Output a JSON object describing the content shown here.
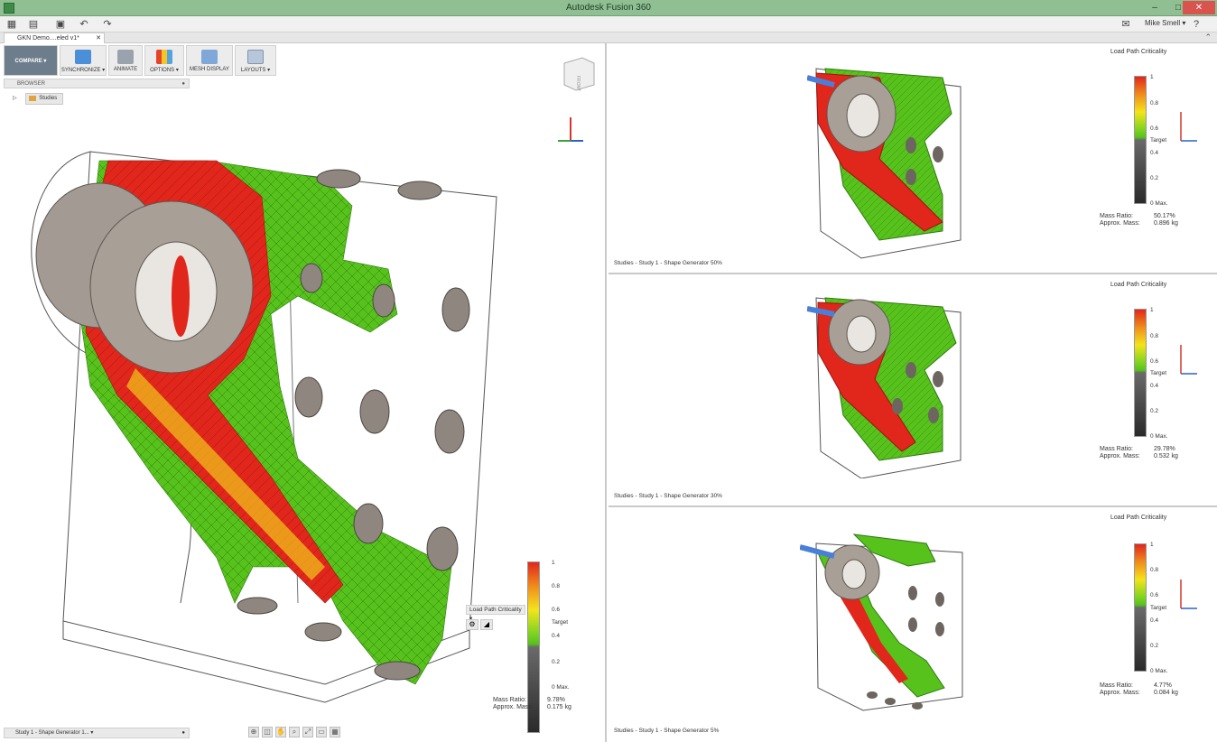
{
  "window": {
    "title": "Autodesk Fusion 360",
    "min": "–",
    "max": "□",
    "close": "✕"
  },
  "quick_access": {
    "user_name": "Mike Smell ▾",
    "help": "?"
  },
  "doc_tab": {
    "label": "GKN Demo....eled v1*",
    "close": "✕"
  },
  "toolbar": {
    "compare": "COMPARE ▾",
    "synchronize": "SYNCHRONIZE ▾",
    "animate": "ANIMATE",
    "options": "OPTIONS ▾",
    "mesh_display": "MESH DISPLAY",
    "layouts": "LAYOUTS ▾"
  },
  "browser": {
    "label": "BROWSER",
    "studies": "Studies"
  },
  "main_view": {
    "legend_dropdown": "Load Path Criticality ▾",
    "legend_ticks": [
      "1",
      "0.8",
      "0.6",
      "Target",
      "0.4",
      "0.2",
      "0 Max."
    ],
    "mass_ratio_label": "Mass Ratio:",
    "mass_ratio_value": "9.78%",
    "approx_mass_label": "Approx. Mass:",
    "approx_mass_value": "0.175 kg",
    "study_dropdown": "Study 1 - Shape Generator 1... ▾"
  },
  "panels": [
    {
      "legend_title": "Load Path Criticality",
      "legend_ticks": [
        "1",
        "0.8",
        "0.6",
        "Target",
        "0.4",
        "0.2",
        "0 Max."
      ],
      "mass_ratio_label": "Mass Ratio:",
      "mass_ratio_value": "50.17%",
      "approx_mass_label": "Approx. Mass:",
      "approx_mass_value": "0.896 kg",
      "study_label": "Studies - Study 1 - Shape Generator 50%"
    },
    {
      "legend_title": "Load Path Criticality",
      "legend_ticks": [
        "1",
        "0.8",
        "0.6",
        "Target",
        "0.4",
        "0.2",
        "0 Max."
      ],
      "mass_ratio_label": "Mass Ratio:",
      "mass_ratio_value": "29.78%",
      "approx_mass_label": "Approx. Mass:",
      "approx_mass_value": "0.532 kg",
      "study_label": "Studies - Study 1 - Shape Generator 30%"
    },
    {
      "legend_title": "Load Path Criticality",
      "legend_ticks": [
        "1",
        "0.8",
        "0.6",
        "Target",
        "0.4",
        "0.2",
        "0 Max."
      ],
      "mass_ratio_label": "Mass Ratio:",
      "mass_ratio_value": "4.77%",
      "approx_mass_label": "Approx. Mass:",
      "approx_mass_value": "0.084 kg",
      "study_label": "Studies - Study 1 - Shape Generator 5%"
    }
  ],
  "colors": {
    "critical": "#e1261c",
    "mid": "#f4e41a",
    "target": "#57c21c",
    "hardware": "#9c948c",
    "frame": "#555555"
  }
}
